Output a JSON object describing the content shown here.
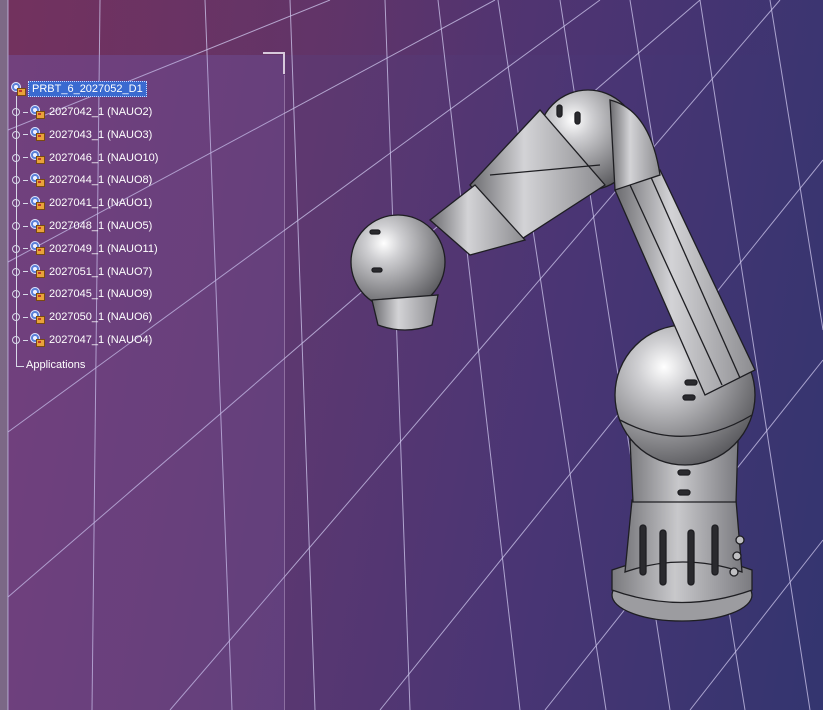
{
  "tree": {
    "root_label": "PRBT_6_2027052_D1",
    "items": [
      {
        "label": "2027042_1 (NAUO2)"
      },
      {
        "label": "2027043_1 (NAUO3)"
      },
      {
        "label": "2027046_1 (NAUO10)"
      },
      {
        "label": "2027044_1 (NAUO8)"
      },
      {
        "label": "2027041_1 (NAUO1)"
      },
      {
        "label": "2027048_1 (NAUO5)"
      },
      {
        "label": "2027049_1 (NAUO11)"
      },
      {
        "label": "2027051_1 (NAUO7)"
      },
      {
        "label": "2027045_1 (NAUO9)"
      },
      {
        "label": "2027050_1 (NAUO6)"
      },
      {
        "label": "2027047_1 (NAUO4)"
      }
    ],
    "applications_label": "Applications"
  },
  "colors": {
    "background_left": "#6e3a72",
    "background_right": "#33356f",
    "selection": "#3a6ad0",
    "robot_gray": "#a9a9ab"
  },
  "icons": {
    "root": "assembly-icon",
    "child": "part-icon"
  }
}
